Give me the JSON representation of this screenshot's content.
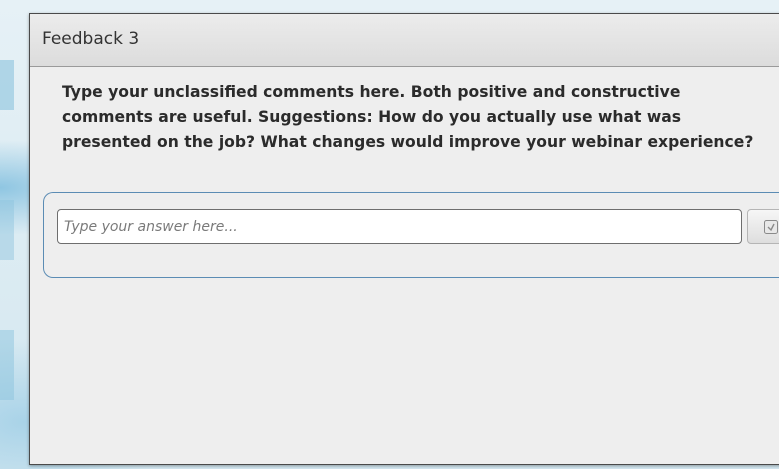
{
  "panel": {
    "title": "Feedback 3"
  },
  "question": {
    "text": "Type your unclassified comments here. Both positive and constructive comments are useful. Suggestions: How do you actually use what was presented on the job? What changes would improve your webinar experience?"
  },
  "answer": {
    "value": "",
    "placeholder": "Type your answer here..."
  },
  "submit": {
    "icon": "send-icon"
  },
  "colors": {
    "backdrop": "#dbeaf2",
    "panel_background": "#eeeeee",
    "frame_border": "#5b8cb4",
    "text": "#2b2b2b"
  }
}
